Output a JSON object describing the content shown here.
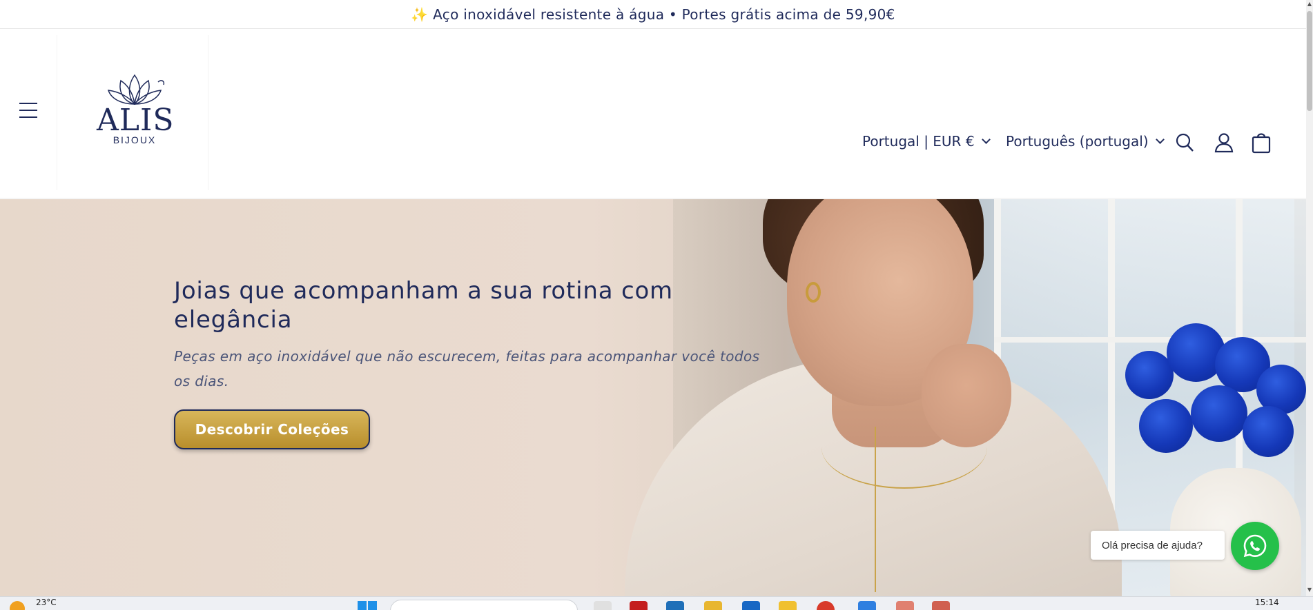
{
  "announcement": {
    "text": "✨ Aço inoxidável resistente à água • Portes grátis acima de 59,90€"
  },
  "header": {
    "logo_brand": "ALIS",
    "logo_sub": "BIJOUX",
    "country_selector": "Portugal | EUR €",
    "language_selector": "Português (portugal)"
  },
  "hero": {
    "title": "Joias que acompanham a sua rotina com elegância",
    "subtitle": "Peças em aço inoxidável que não escurecem, feitas para acompanhar você todos os dias.",
    "cta_label": "Descobrir Coleções"
  },
  "whatsapp": {
    "bubble_text": "Olá precisa de ajuda?"
  },
  "taskbar": {
    "temperature": "23°C",
    "clock": "15:14"
  },
  "colors": {
    "brand_navy": "#1f2a5a",
    "cta_gold": "#c9a040",
    "whatsapp_green": "#25c04a"
  }
}
